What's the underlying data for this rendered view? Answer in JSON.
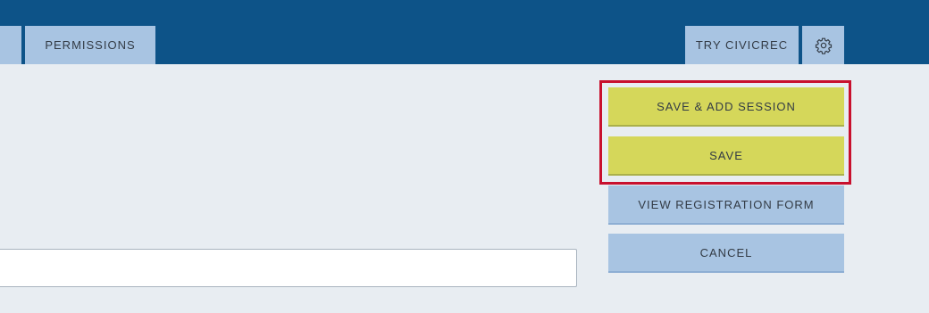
{
  "header": {
    "tabs": [
      {
        "label": ""
      },
      {
        "label": "PERMISSIONS"
      },
      {
        "label": "TRY CIVICREC"
      }
    ],
    "settings_icon": "gear-icon"
  },
  "actions": {
    "save_add_session_label": "SAVE & ADD SESSION",
    "save_label": "SAVE",
    "view_registration_label": "VIEW REGISTRATION FORM",
    "cancel_label": "CANCEL"
  },
  "form": {
    "input_value": ""
  },
  "colors": {
    "header_bg": "#0d5388",
    "tab_bg": "#a8c4e2",
    "primary_button": "#d5d75a",
    "secondary_button": "#a8c4e2",
    "highlight_border": "#c8102e",
    "page_bg": "#e8edf2"
  }
}
